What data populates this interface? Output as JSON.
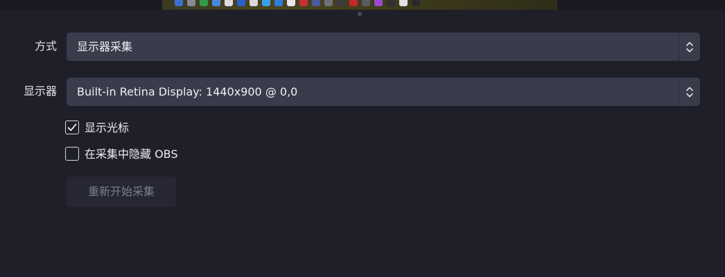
{
  "method": {
    "label": "方式",
    "value": "显示器采集"
  },
  "display": {
    "label": "显示器",
    "value": "Built-in Retina Display: 1440x900 @ 0,0"
  },
  "options": {
    "show_cursor": {
      "label": "显示光标",
      "checked": true
    },
    "hide_obs": {
      "label": "在采集中隐藏 OBS",
      "checked": false
    }
  },
  "restart_button": {
    "label": "重新开始采集",
    "enabled": false
  },
  "colors": {
    "background": "#1e1f29",
    "select_background": "#3a3c4c",
    "button_disabled_background": "#262733",
    "button_disabled_text": "#7d7f8c"
  }
}
